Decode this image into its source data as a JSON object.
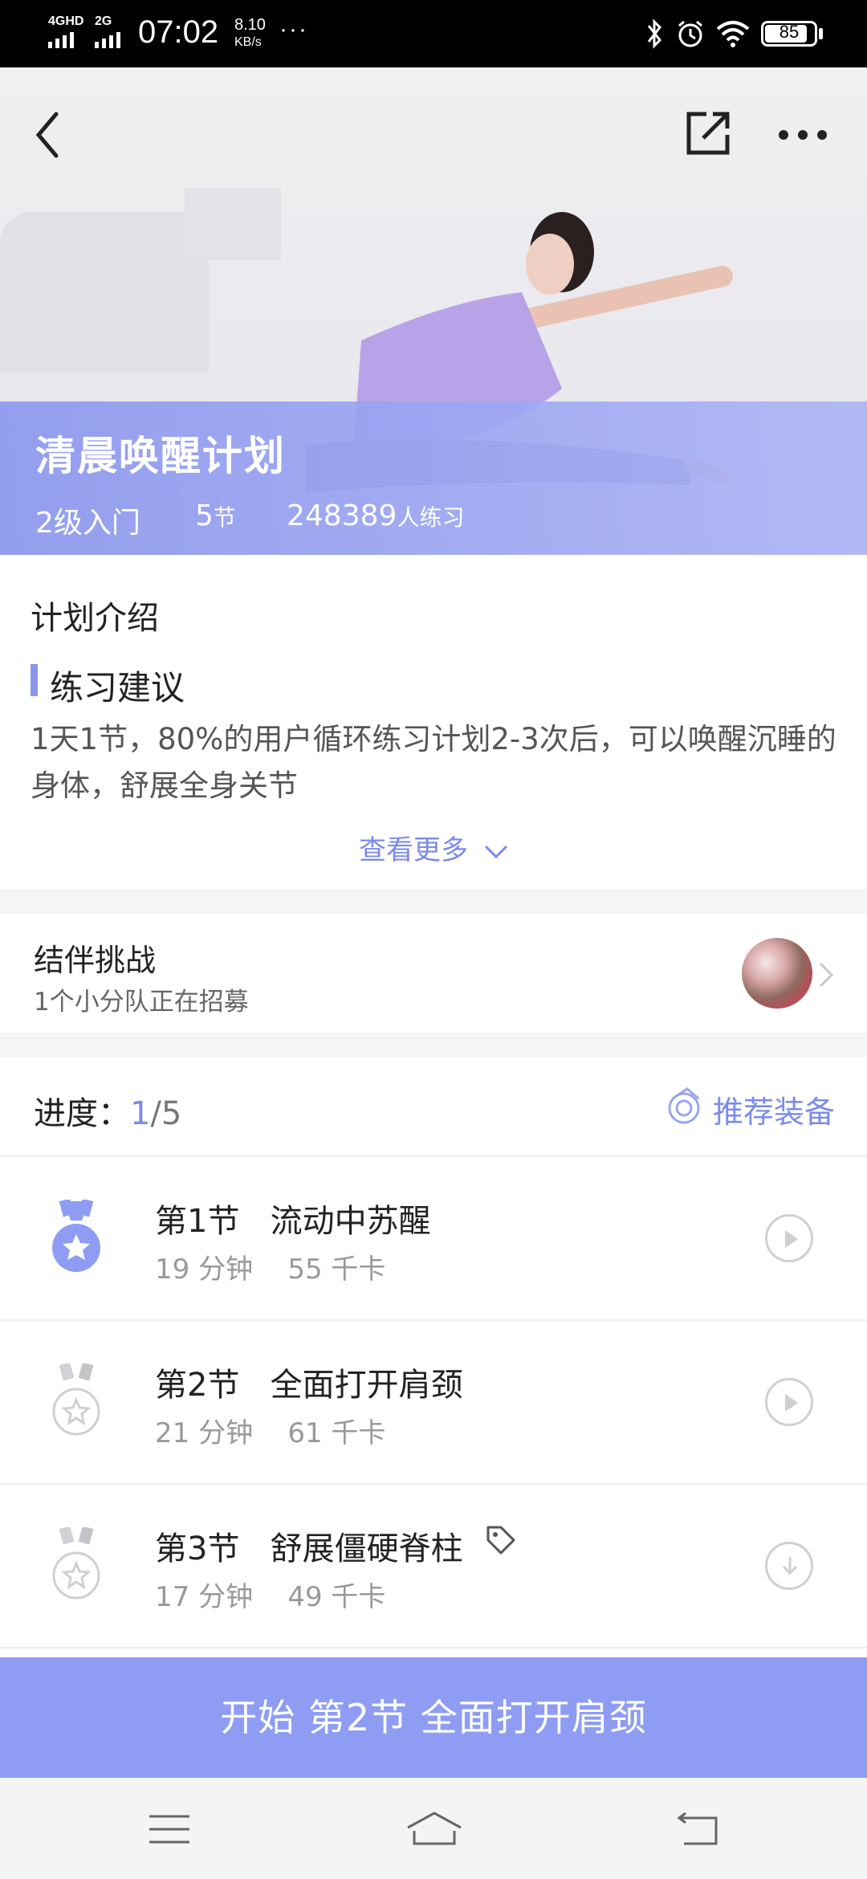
{
  "status_bar": {
    "network1": "4GHD",
    "network2": "2G",
    "time": "07:02",
    "speed_value": "8.10",
    "speed_unit": "KB/s",
    "more": "···",
    "battery": "85"
  },
  "hero": {
    "title": "清晨唤醒计划",
    "level": "2级入门",
    "sessions_num": "5",
    "sessions_unit": "节",
    "participants_num": "248389",
    "participants_unit": "人练习"
  },
  "intro": {
    "heading": "计划介绍",
    "tip_title": "练习建议",
    "tip_text": "1天1节，80%的用户循环练习计划2-3次后，可以唤醒沉睡的身体，舒展全身关节",
    "more_link": "查看更多"
  },
  "team": {
    "title": "结伴挑战",
    "subtitle": "1个小分队正在招募"
  },
  "progress": {
    "label": "进度：",
    "current": "1",
    "total": "/5",
    "equipment_link": "推荐装备"
  },
  "lessons": [
    {
      "number": "第1节",
      "name": "流动中苏醒",
      "duration": "19 分钟",
      "calories": "55 千卡",
      "completed": true,
      "action": "play"
    },
    {
      "number": "第2节",
      "name": "全面打开肩颈",
      "duration": "21 分钟",
      "calories": "61 千卡",
      "completed": false,
      "action": "play"
    },
    {
      "number": "第3节",
      "name": "舒展僵硬脊柱",
      "duration": "17 分钟",
      "calories": "49 千卡",
      "completed": false,
      "action": "download"
    }
  ],
  "start_button": "开始 第2节 全面打开肩颈",
  "colors": {
    "accent": "#8e9df3",
    "link": "#7b8be8",
    "hero_overlay": "#8c98ee"
  }
}
